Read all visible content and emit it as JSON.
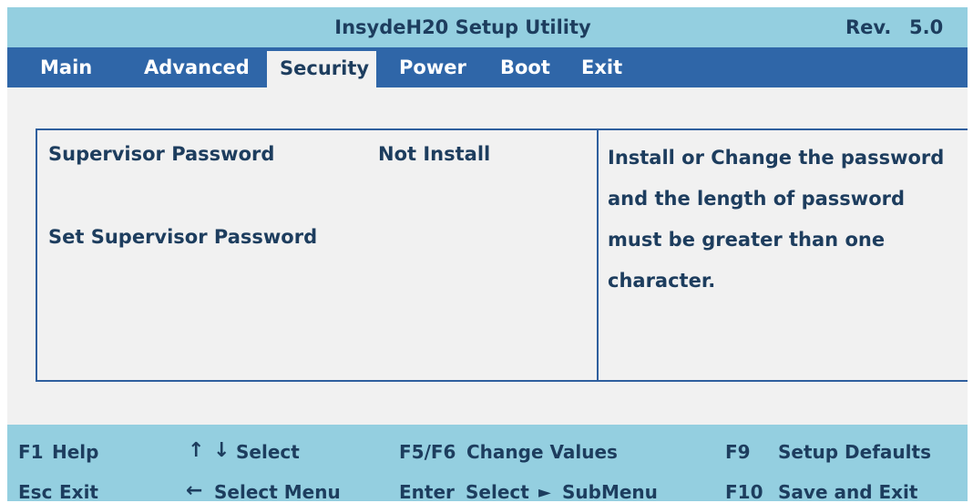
{
  "header": {
    "title": "InsydeH20 Setup Utility",
    "rev_label": "Rev.",
    "rev_value": "5.0"
  },
  "menu": {
    "tabs": [
      {
        "label": "Main"
      },
      {
        "label": "Advanced"
      },
      {
        "label": "Security",
        "active": true
      },
      {
        "label": "Power"
      },
      {
        "label": "Boot"
      },
      {
        "label": "Exit"
      }
    ]
  },
  "security": {
    "supervisor_password_label": "Supervisor Password",
    "supervisor_password_value": "Not Install",
    "set_supervisor_password_label": "Set Supervisor Password",
    "help_lines": [
      "Install or Change the password",
      "and the length of password",
      "must be greater than one",
      "character."
    ]
  },
  "footer": {
    "f1_key": "F1",
    "f1_action": "Help",
    "updown_action": "Select",
    "f5f6_key": "F5/F6",
    "f5f6_action": "Change Values",
    "f9_key": "F9",
    "f9_action": "Setup Defaults",
    "esc_key": "Esc",
    "esc_action": "Exit",
    "left_action": "Select Menu",
    "enter_key": "Enter",
    "enter_action": "Select",
    "submenu_action": "SubMenu",
    "f10_key": "F10",
    "f10_action": "Save and Exit"
  },
  "colors": {
    "title_bar": "#94cfe0",
    "menu_bar": "#2f66a8",
    "panel_border": "#2f5f9e",
    "text": "#1d3d5e",
    "background": "#f1f1f1"
  },
  "icons": [
    "up-arrow-icon",
    "down-arrow-icon",
    "left-arrow-icon",
    "right-triangle-icon"
  ]
}
